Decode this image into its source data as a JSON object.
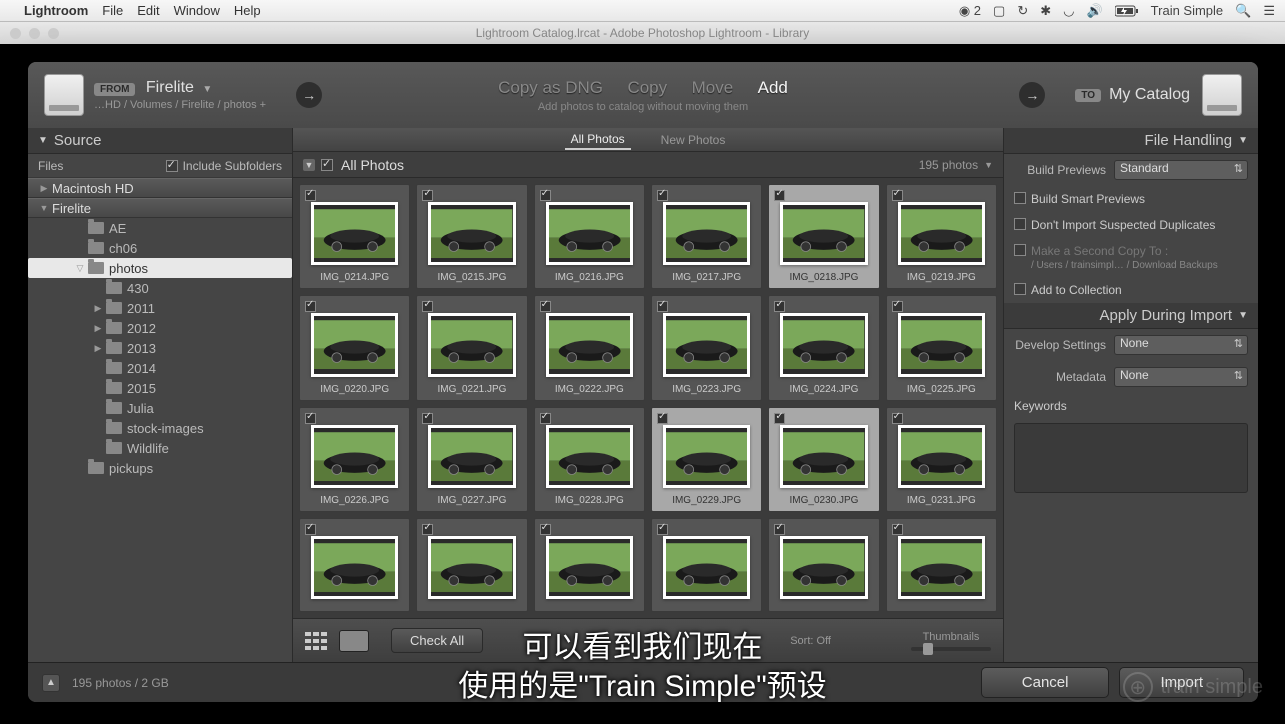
{
  "menubar": {
    "app": "Lightroom",
    "items": [
      "File",
      "Edit",
      "Window",
      "Help"
    ],
    "right_count": "2",
    "user": "Train Simple"
  },
  "titlebar": "Lightroom Catalog.lrcat - Adobe Photoshop Lightroom - Library",
  "header": {
    "from_badge": "FROM",
    "from_name": "Firelite",
    "from_path": "…HD / Volumes / Firelite / photos +",
    "modes": {
      "copydng": "Copy as DNG",
      "copy": "Copy",
      "move": "Move",
      "add": "Add"
    },
    "sub": "Add photos to catalog without moving them",
    "to_badge": "TO",
    "to_name": "My Catalog"
  },
  "left": {
    "source": "Source",
    "files": "Files",
    "include": "Include Subfolders",
    "volumes": {
      "mac": "Macintosh HD",
      "fire": "Firelite"
    },
    "tree": [
      {
        "name": "AE",
        "depth": 2,
        "exp": "",
        "sel": false
      },
      {
        "name": "ch06",
        "depth": 2,
        "exp": "",
        "sel": false
      },
      {
        "name": "photos",
        "depth": 2,
        "exp": "▽",
        "sel": true
      },
      {
        "name": "430",
        "depth": 3,
        "exp": "",
        "sel": false
      },
      {
        "name": "2011",
        "depth": 3,
        "exp": "▶",
        "sel": false
      },
      {
        "name": "2012",
        "depth": 3,
        "exp": "▶",
        "sel": false
      },
      {
        "name": "2013",
        "depth": 3,
        "exp": "▶",
        "sel": false
      },
      {
        "name": "2014",
        "depth": 3,
        "exp": "",
        "sel": false
      },
      {
        "name": "2015",
        "depth": 3,
        "exp": "",
        "sel": false
      },
      {
        "name": "Julia",
        "depth": 3,
        "exp": "",
        "sel": false
      },
      {
        "name": "stock-images",
        "depth": 3,
        "exp": "",
        "sel": false
      },
      {
        "name": "Wildlife",
        "depth": 3,
        "exp": "",
        "sel": false
      },
      {
        "name": "pickups",
        "depth": 2,
        "exp": "",
        "sel": false
      }
    ]
  },
  "center": {
    "tab_all": "All Photos",
    "tab_new": "New Photos",
    "grid_title": "All Photos",
    "count": "195 photos",
    "files": [
      {
        "n": "IMG_0214.JPG",
        "hl": false
      },
      {
        "n": "IMG_0215.JPG",
        "hl": false
      },
      {
        "n": "IMG_0216.JPG",
        "hl": false
      },
      {
        "n": "IMG_0217.JPG",
        "hl": false
      },
      {
        "n": "IMG_0218.JPG",
        "hl": true
      },
      {
        "n": "IMG_0219.JPG",
        "hl": false
      },
      {
        "n": "IMG_0220.JPG",
        "hl": false
      },
      {
        "n": "IMG_0221.JPG",
        "hl": false
      },
      {
        "n": "IMG_0222.JPG",
        "hl": false
      },
      {
        "n": "IMG_0223.JPG",
        "hl": false
      },
      {
        "n": "IMG_0224.JPG",
        "hl": false
      },
      {
        "n": "IMG_0225.JPG",
        "hl": false
      },
      {
        "n": "IMG_0226.JPG",
        "hl": false
      },
      {
        "n": "IMG_0227.JPG",
        "hl": false
      },
      {
        "n": "IMG_0228.JPG",
        "hl": false
      },
      {
        "n": "IMG_0229.JPG",
        "hl": true
      },
      {
        "n": "IMG_0230.JPG",
        "hl": true
      },
      {
        "n": "IMG_0231.JPG",
        "hl": false
      },
      {
        "n": "",
        "hl": false
      },
      {
        "n": "",
        "hl": false
      },
      {
        "n": "",
        "hl": false
      },
      {
        "n": "",
        "hl": false
      },
      {
        "n": "",
        "hl": false
      },
      {
        "n": "",
        "hl": false
      }
    ],
    "check_all": "Check All",
    "sort": "Sort:",
    "sort_val": "Off",
    "thumbs_lbl": "Thumbnails"
  },
  "right": {
    "filehandling": "File Handling",
    "build_previews": "Build Previews",
    "build_val": "Standard",
    "smart": "Build Smart Previews",
    "dup": "Don't Import Suspected Duplicates",
    "second": "Make a Second Copy To :",
    "second_path": "/ Users / trainsimpl… / Download Backups",
    "addcol": "Add to Collection",
    "apply": "Apply During Import",
    "dev": "Develop Settings",
    "dev_val": "None",
    "meta": "Metadata",
    "meta_val": "None",
    "keywords": "Keywords"
  },
  "footer": {
    "status": "195 photos / 2 GB",
    "cancel": "Cancel",
    "import": "Import"
  },
  "subtitles": {
    "l1": "可以看到我们现在",
    "l2": "使用的是\"Train Simple\"预设"
  },
  "watermark": "train simple"
}
